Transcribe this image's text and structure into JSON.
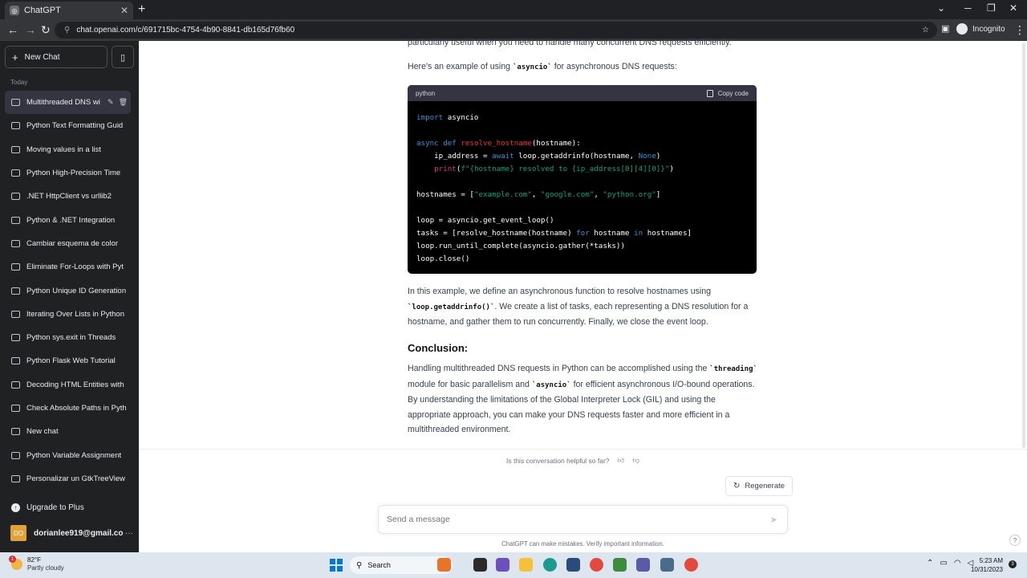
{
  "browser": {
    "tab_title": "ChatGPT",
    "url": "chat.openai.com/c/691715bc-4754-4b90-8841-db165d76fb60",
    "incognito_label": "Incognito"
  },
  "sidebar": {
    "new_chat_label": "New Chat",
    "section_label": "Today",
    "items": [
      {
        "label": "Multithreaded DNS wi",
        "active": true
      },
      {
        "label": "Python Text Formatting Guid"
      },
      {
        "label": "Moving values in a list"
      },
      {
        "label": "Python High-Precision Time"
      },
      {
        "label": ".NET HttpClient vs urllib2"
      },
      {
        "label": "Python & .NET Integration"
      },
      {
        "label": "Cambiar esquema de color"
      },
      {
        "label": "Eliminate For-Loops with Pyt"
      },
      {
        "label": "Python Unique ID Generation"
      },
      {
        "label": "Iterating Over Lists in Python"
      },
      {
        "label": "Python sys.exit in Threads"
      },
      {
        "label": "Python Flask Web Tutorial"
      },
      {
        "label": "Decoding HTML Entities with"
      },
      {
        "label": "Check Absolute Paths in Pyth"
      },
      {
        "label": "New chat"
      },
      {
        "label": "Python Variable Assignment"
      },
      {
        "label": "Personalizar un GtkTreeView"
      }
    ],
    "upgrade_label": "Upgrade to Plus",
    "user_initials": "DO",
    "user_email": "dorianlee919@gmail.co"
  },
  "main": {
    "top_partial": "particularly useful when you need to handle many concurrent DNS requests efficiently.",
    "intro_pre": "Here's an example of using ",
    "intro_code": "`asyncio`",
    "intro_post": " for asynchronous DNS requests:",
    "code_lang": "python",
    "copy_label": "Copy code",
    "explain_pre": "In this example, we define an asynchronous function to resolve hostnames using ",
    "explain_code": "`loop.getaddrinfo()`",
    "explain_post": ". We create a list of tasks, each representing a DNS resolution for a hostname, and gather them to run concurrently. Finally, we close the event loop.",
    "conclusion_heading": "Conclusion:",
    "concl_pre": "Handling multithreaded DNS requests in Python can be accomplished using the ",
    "concl_code1": "`threading`",
    "concl_mid": " module for basic parallelism and ",
    "concl_code2": "`asyncio`",
    "concl_post": " for efficient asynchronous I/O-bound operations. By understanding the limitations of the Global Interpreter Lock (GIL) and using the appropriate approach, you can make your DNS requests faster and more efficient in a multithreaded environment.",
    "helpful_question": "Is this conversation helpful so far?",
    "regenerate_label": "Regenerate",
    "message_placeholder": "Send a message",
    "disclaimer": "ChatGPT can make mistakes. Verify important information.",
    "help_label": "?"
  },
  "taskbar": {
    "temperature": "82°F",
    "weather_desc": "Partly cloudy",
    "weather_badge": "1",
    "search_label": "Search",
    "time": "5:23 AM",
    "date": "10/31/2023",
    "notif_count": "3"
  }
}
